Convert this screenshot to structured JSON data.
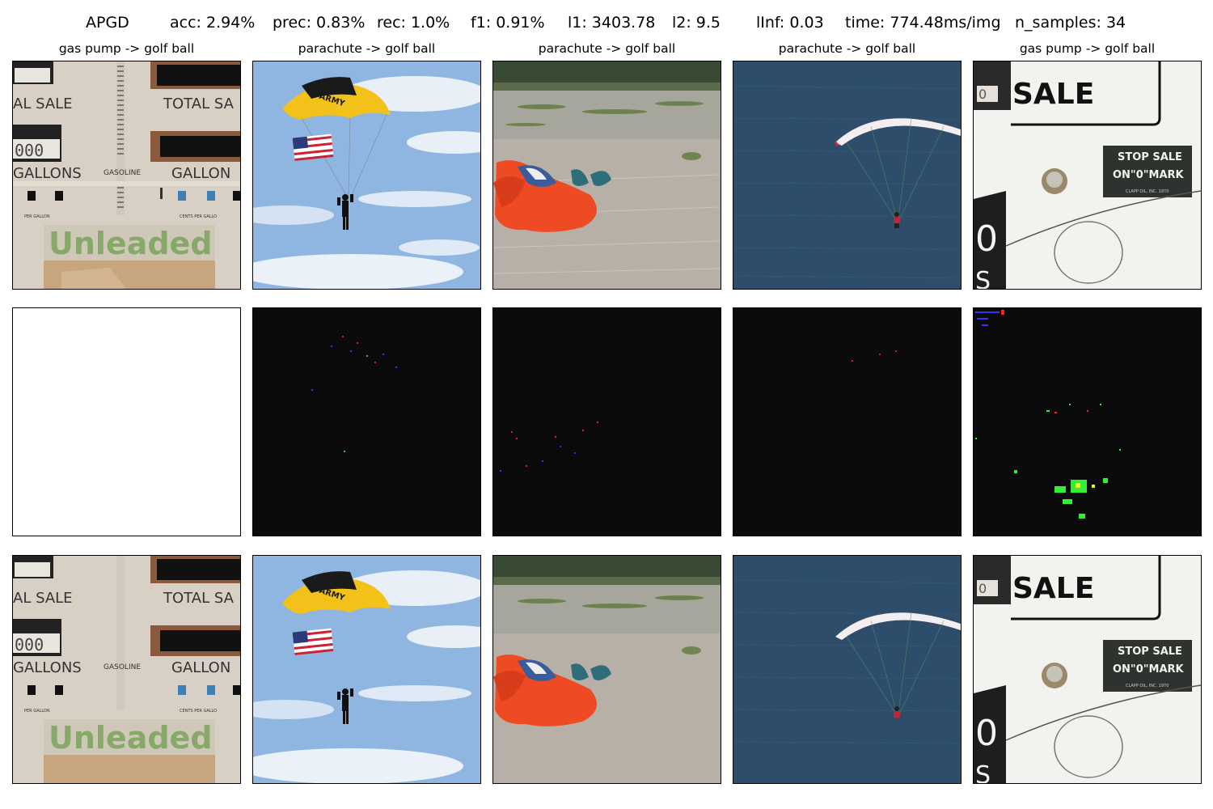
{
  "header": {
    "method": "APGD",
    "acc": "acc: 2.94%",
    "prec": "prec: 0.83%",
    "rec": "rec: 1.0%",
    "f1": "f1: 0.91%",
    "l1": "l1: 3403.78",
    "l2": "l2: 9.5",
    "linf": "lInf: 0.03",
    "time": "time: 774.48ms/img",
    "n_samples": "n_samples: 34"
  },
  "columns": [
    {
      "title": "gas pump -> golf ball",
      "scene": "gas-pump-1"
    },
    {
      "title": "parachute -> golf ball",
      "scene": "parachute-flag"
    },
    {
      "title": "parachute -> golf ball",
      "scene": "parachute-landed"
    },
    {
      "title": "parachute -> golf ball",
      "scene": "paraglider-sea"
    },
    {
      "title": "gas pump -> golf ball",
      "scene": "gas-pump-2"
    }
  ],
  "image_text": {
    "sale": "SALE",
    "total_sale": "TOTAL SA",
    "al_sale": "AL  SALE",
    "gallons": "GALLONS",
    "gallon": "GALLON",
    "gasoline": "GASOLINE",
    "unleaded": "Unleaded",
    "stop_sale": "STOP SALE",
    "on_0_mark": "ON\"0\"MARK",
    "army": "ARMY",
    "clapp": "CLAPP OIL, INC. 1970",
    "per_gallon": "PER  GALLON",
    "cents_per_gallon": "CENTS  PER  GALLO"
  },
  "colors": {
    "sky": "#8fb6e0",
    "sea": "#2e4d6b",
    "sand": "#b7b0a6",
    "parachute_orange": "#ee4a23",
    "canopy_yellow": "#f2c21a",
    "perturbation_bg": "#0b0b0b"
  }
}
